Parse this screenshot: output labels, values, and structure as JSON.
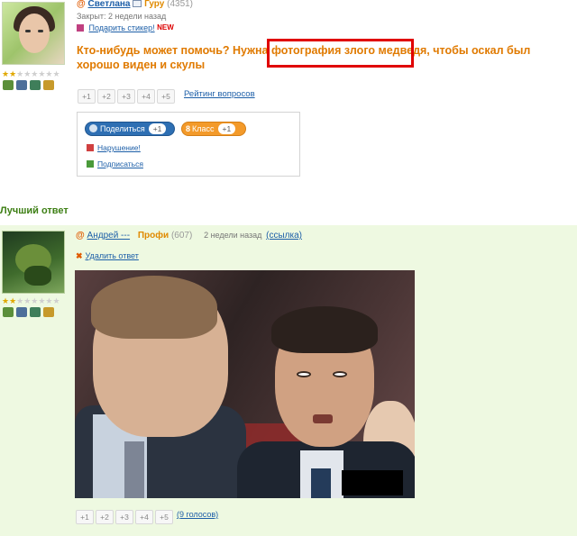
{
  "question": {
    "author": {
      "name": "Светлана",
      "rank": "Гуру",
      "score": "(4351)",
      "rating_stars": 2,
      "rating_max": 8
    },
    "status": "Закрыт: 2 недели назад",
    "sticker_link": "Подарить стикер!",
    "new_badge": "NEW",
    "title": "Кто-нибудь может помочь? Нужна фотография злого медведя, чтобы оскал был хорошо виден и скулы",
    "vote_buttons": [
      "+1",
      "+2",
      "+3",
      "+4",
      "+5"
    ],
    "rating_link": "Рейтинг вопросов",
    "share": {
      "share_label": "Поделиться",
      "share_count": "+1",
      "class_label": "Класс",
      "class_count": "+1",
      "report": "Нарушение!",
      "subscribe": "Подписаться"
    }
  },
  "best_answer": {
    "heading": "Лучший ответ",
    "author": {
      "name": "Андрей ---",
      "rank": "Профи",
      "score": "(607)",
      "rating_stars": 2,
      "rating_max": 8
    },
    "time": "2 недели назад",
    "link": "(ссылка)",
    "delete_link": "Удалить ответ",
    "vote_buttons": [
      "+1",
      "+2",
      "+3",
      "+4",
      "+5"
    ],
    "votes_count": "(9 голосов)"
  },
  "colors": {
    "accent_orange": "#e07a00",
    "link_blue": "#1d5fa8",
    "answer_bg": "#eef9e1",
    "highlight_red": "#e00000"
  }
}
